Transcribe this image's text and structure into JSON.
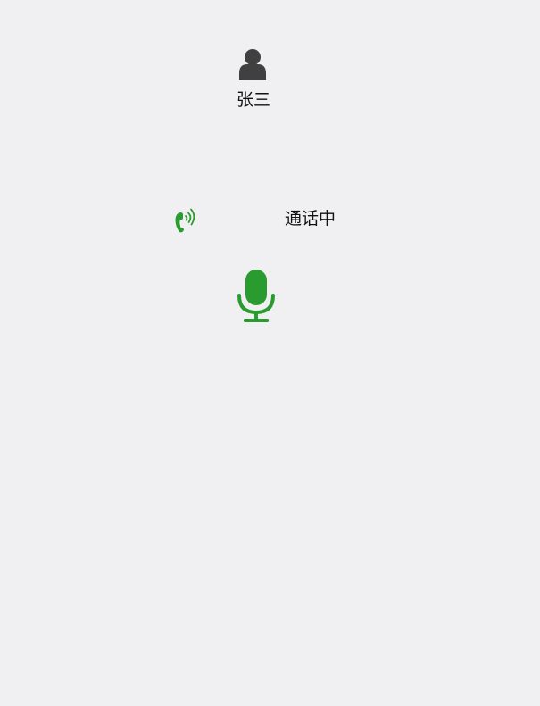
{
  "contact": {
    "name": "张三",
    "avatar_icon": "user-icon",
    "avatar_color": "#404040"
  },
  "call": {
    "status_text": "通话中",
    "status_icon": "phone-ringing-icon",
    "accent_color": "#2a9b2f"
  },
  "controls": {
    "microphone_icon": "microphone-icon"
  }
}
